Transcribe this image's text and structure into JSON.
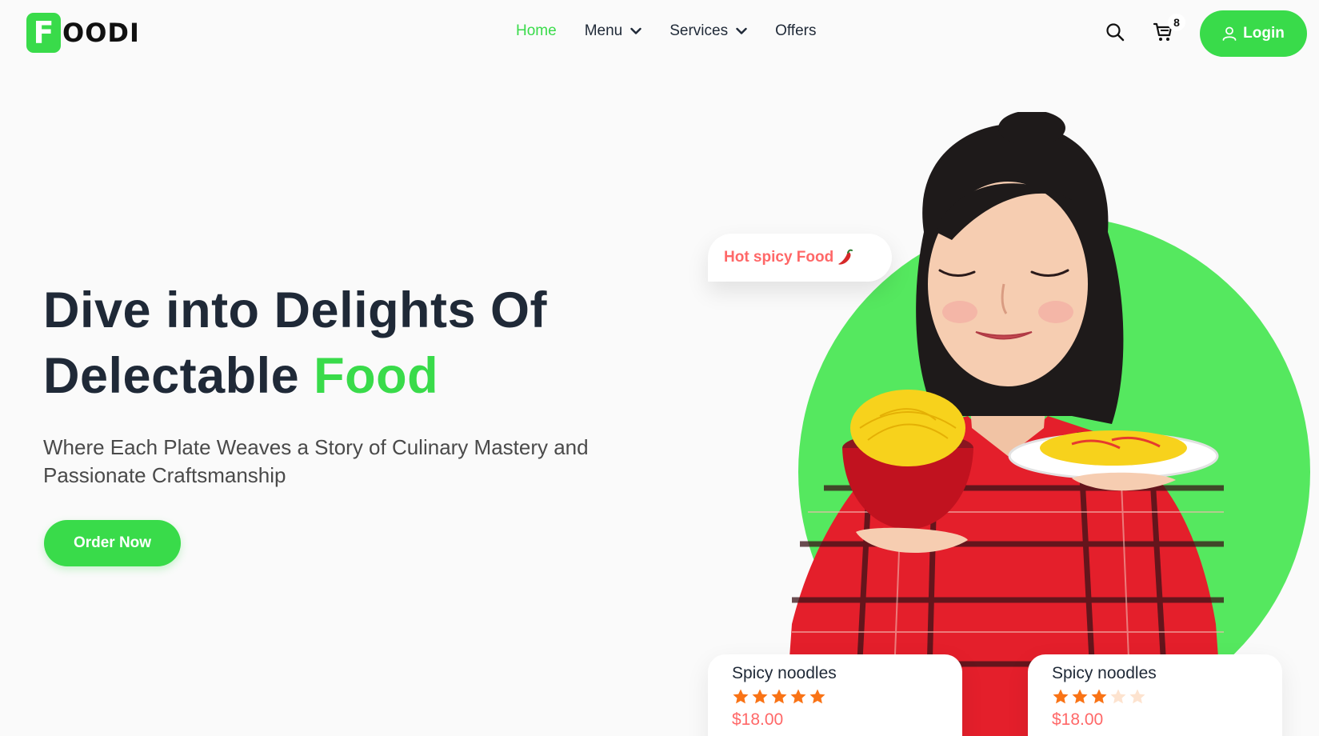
{
  "brand": {
    "logo_letter": "F",
    "logo_text": "OODI",
    "accent_color": "#39db4a"
  },
  "nav": {
    "items": [
      {
        "label": "Home",
        "active": true,
        "dropdown": false
      },
      {
        "label": "Menu",
        "active": false,
        "dropdown": true
      },
      {
        "label": "Services",
        "active": false,
        "dropdown": true
      },
      {
        "label": "Offers",
        "active": false,
        "dropdown": false
      }
    ],
    "search_icon": "search-icon",
    "cart_icon": "cart-icon",
    "cart_count": "8",
    "login_label": "Login",
    "login_icon": "user-icon"
  },
  "hero": {
    "title_line1": "Dive into Delights Of",
    "title_line2_prefix": "Delectable ",
    "title_accent": "Food",
    "subtitle": "Where Each Plate Weaves a Story of Culinary Mastery and Passionate Craftsmanship",
    "cta_label": "Order Now",
    "badge_text": "Hot spicy Food",
    "badge_icon": "chili-pepper-icon"
  },
  "cards": [
    {
      "title": "Spicy noodles",
      "rating": 5,
      "max_rating": 5,
      "price": "$18.00"
    },
    {
      "title": "Spicy noodles",
      "rating": 3,
      "max_rating": 5,
      "price": "$18.00"
    }
  ],
  "colors": {
    "green": "#39db4a",
    "circle": "#55e85f",
    "price": "#ff6868",
    "star": "#f97316"
  }
}
